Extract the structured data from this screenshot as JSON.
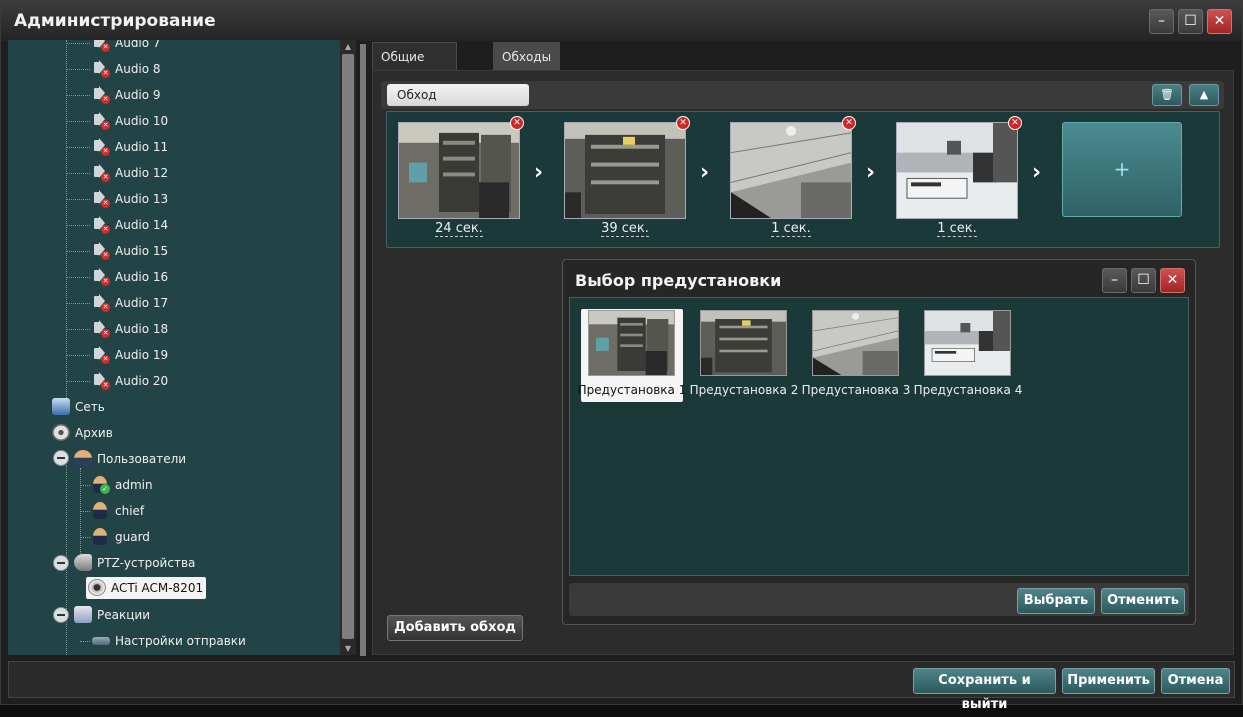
{
  "window": {
    "title": "Администрирование"
  },
  "tree": {
    "audio_items": [
      "Audio 7",
      "Audio 8",
      "Audio 9",
      "Audio 10",
      "Audio 11",
      "Audio 12",
      "Audio 13",
      "Audio 14",
      "Audio 15",
      "Audio 16",
      "Audio 17",
      "Audio 18",
      "Audio 19",
      "Audio 20"
    ],
    "network": "Сеть",
    "archive": "Архив",
    "users": "Пользователи",
    "user_items": [
      "admin",
      "chief",
      "guard"
    ],
    "ptz": "PTZ-устройства",
    "ptz_items": [
      "ACTi ACM-8201"
    ],
    "reactions": "Реакции",
    "reaction_items": [
      "Настройки отправки"
    ]
  },
  "tabs": {
    "general": "Общие настройки",
    "tours": "Обходы"
  },
  "tour": {
    "name": "Обход",
    "delete_icon": "trash-icon",
    "collapse_icon": "chevron-up-icon",
    "steps": [
      {
        "time": "24 сек."
      },
      {
        "time": "39 сек."
      },
      {
        "time": "1 сек."
      },
      {
        "time": "1 сек."
      }
    ],
    "add_symbol": "+",
    "add_tour_label": "Добавить обход"
  },
  "dialog": {
    "title": "Выбор предустановки",
    "presets": [
      "Предустановка 1",
      "Предустановка 2",
      "Предустановка 3",
      "Предустановка 4"
    ],
    "selected_index": 0,
    "select_label": "Выбрать",
    "cancel_label": "Отменить"
  },
  "footer": {
    "save_exit": "Сохранить и выйти",
    "apply": "Применить",
    "cancel": "Отмена"
  },
  "colors": {
    "accent": "#2f6266",
    "panel": "#234446",
    "close": "#c03a3a"
  }
}
